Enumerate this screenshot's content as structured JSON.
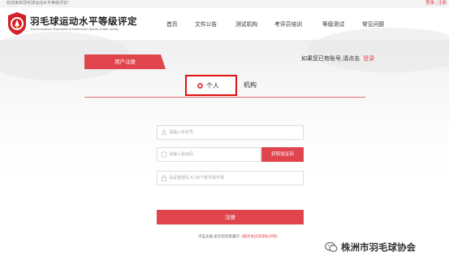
{
  "top_bar": {
    "welcome": "欢迎来到羽毛球运动水平等级评定!",
    "login": "登录",
    "separator": "|",
    "register": "注册"
  },
  "header": {
    "title": "羽毛球运动水平等级评定",
    "subtitle": "the Evaluation Standards of Badminton Sports Grade Levels",
    "nav": [
      "首页",
      "文件公告",
      "测试机构",
      "考评员培训",
      "等级测试",
      "常见问题"
    ]
  },
  "register": {
    "tab_label": "用户注册",
    "login_hint": "如果您已有账号,请点击",
    "login_link": "登录",
    "types": {
      "personal": "个人",
      "org": "机构",
      "selected": "personal"
    },
    "fields": {
      "phone_placeholder": "请输入手机号",
      "code_placeholder": "请输入验证码",
      "password_placeholder": "请设置密码 6-18个数字或字母"
    },
    "get_code_button": "获取验证码",
    "submit_button": "注册",
    "agree_text": "点击注册,表示您同意遵守",
    "agree_link": "《服务协议及隐私声明》"
  },
  "watermark": {
    "text": "株洲市羽毛球协会"
  },
  "colors": {
    "accent": "#e0444d",
    "highlight_box": "#e01010"
  }
}
